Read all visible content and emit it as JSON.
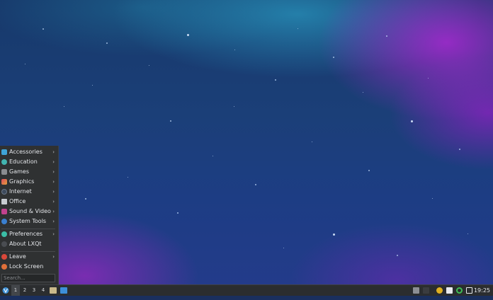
{
  "menu": {
    "categories": [
      {
        "label": "Accessories",
        "icon": "accessories-icon",
        "color": "#3fa4d8"
      },
      {
        "label": "Education",
        "icon": "education-icon",
        "color": "#42b4b0"
      },
      {
        "label": "Games",
        "icon": "games-icon",
        "color": "#8a8c90"
      },
      {
        "label": "Graphics",
        "icon": "graphics-icon",
        "color": "#e08a3c"
      },
      {
        "label": "Internet",
        "icon": "internet-icon",
        "color": "#3d4a5c"
      },
      {
        "label": "Office",
        "icon": "office-icon",
        "color": "#c8ccd2"
      },
      {
        "label": "Sound & Video",
        "icon": "sound-video-icon",
        "color": "#c2428e"
      },
      {
        "label": "System Tools",
        "icon": "system-tools-icon",
        "color": "#3a7fcf"
      }
    ],
    "preferences": {
      "label": "Preferences",
      "icon": "preferences-icon",
      "color": "#3bbda6"
    },
    "about": {
      "label": "About LXQt",
      "icon": "lxqt-icon",
      "color": "#4a4d52"
    },
    "leave": {
      "label": "Leave",
      "icon": "leave-icon",
      "color": "#d9483a"
    },
    "lock": {
      "label": "Lock Screen",
      "icon": "lock-screen-icon",
      "color": "#e0703a"
    },
    "arrow": "›",
    "search_placeholder": "Search..."
  },
  "taskbar": {
    "start_icon": "lxqt-start-icon",
    "workspaces": [
      "1",
      "2",
      "3",
      "4"
    ],
    "active_workspace": "1",
    "clock": "19:25"
  }
}
